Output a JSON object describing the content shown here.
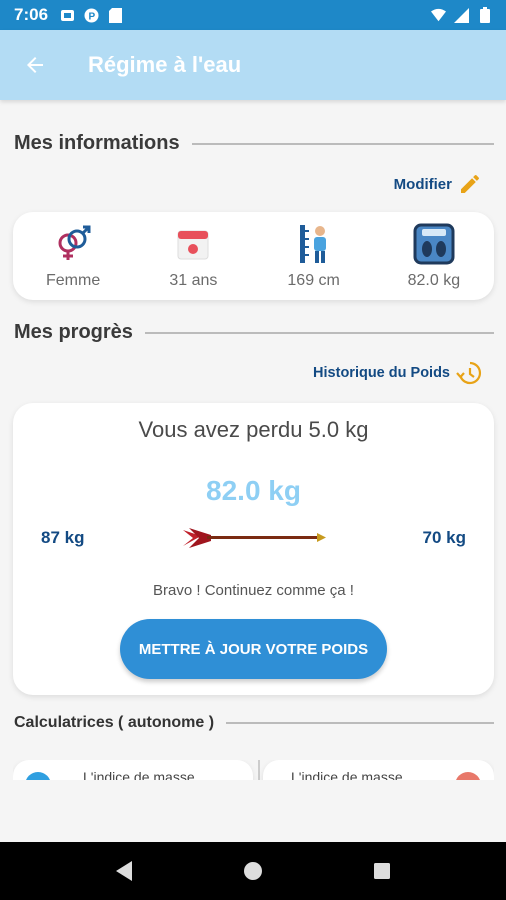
{
  "status_bar": {
    "time": "7:06"
  },
  "app_bar": {
    "title": "Régime à l'eau"
  },
  "info_section": {
    "heading": "Mes informations",
    "edit_label": "Modifier",
    "items": [
      {
        "icon": "gender-icon",
        "value": "Femme"
      },
      {
        "icon": "calendar-icon",
        "value": "31 ans"
      },
      {
        "icon": "height-icon",
        "value": "169 cm"
      },
      {
        "icon": "scale-icon",
        "value": "82.0 kg"
      }
    ]
  },
  "progress_section": {
    "heading": "Mes progrès",
    "history_label": "Historique du Poids",
    "lost_text": "Vous avez perdu 5.0 kg",
    "current_weight": "82.0 kg",
    "start_weight": "87 kg",
    "goal_weight": "70 kg",
    "encouragement": "Bravo ! Continuez comme ça !",
    "update_button": "METTRE À JOUR VOTRE POIDS"
  },
  "calculators": {
    "heading": "Calculatrices ( autonome )",
    "items": [
      {
        "label": "L'indice de masse"
      },
      {
        "label": "L'indice de masse"
      }
    ]
  },
  "colors": {
    "status_bar": "#1e88c8",
    "app_bar": "#b3dcf4",
    "accent_blue": "#2f8fd6",
    "navy": "#134a83",
    "current_weight": "#8ecff4"
  }
}
